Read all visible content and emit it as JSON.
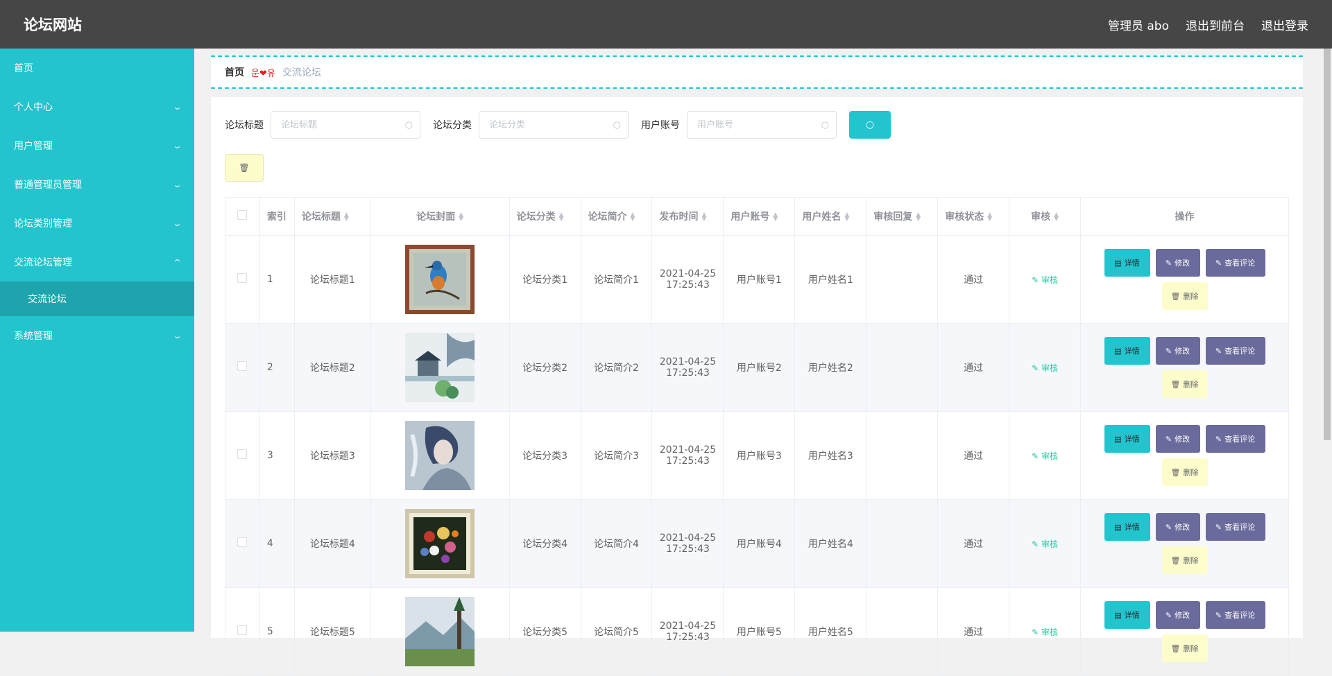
{
  "header": {
    "brand": "论坛网站",
    "admin_label": "管理员 abo",
    "back_to_front": "退出到前台",
    "logout": "退出登录"
  },
  "sidebar": {
    "items": [
      {
        "label": "首页",
        "has_arrow": false
      },
      {
        "label": "个人中心",
        "has_arrow": true
      },
      {
        "label": "用户管理",
        "has_arrow": true
      },
      {
        "label": "普通管理员管理",
        "has_arrow": true
      },
      {
        "label": "论坛类别管理",
        "has_arrow": true
      },
      {
        "label": "交流论坛管理",
        "has_arrow": true,
        "expanded": true
      },
      {
        "label": "系统管理",
        "has_arrow": true
      }
    ],
    "sub_item": "交流论坛"
  },
  "breadcrumb": {
    "home": "首页",
    "separator": "운❤유",
    "current": "交流论坛"
  },
  "search": {
    "title_label": "论坛标题",
    "title_placeholder": "论坛标题",
    "category_label": "论坛分类",
    "category_placeholder": "论坛分类",
    "account_label": "用户账号",
    "account_placeholder": "用户账号"
  },
  "table": {
    "headers": {
      "index": "索引",
      "title": "论坛标题",
      "cover": "论坛封面",
      "category": "论坛分类",
      "intro": "论坛简介",
      "time": "发布时间",
      "account": "用户账号",
      "name": "用户姓名",
      "reply": "审核回复",
      "status": "审核状态",
      "audit": "审核",
      "ops": "操作"
    },
    "rows": [
      {
        "index": "1",
        "title": "论坛标题1",
        "cover": "kingfisher painting",
        "category": "论坛分类1",
        "intro": "论坛简介1",
        "date": "2021-04-25",
        "time": "17:25:43",
        "account": "用户账号1",
        "name": "用户姓名1",
        "reply": "",
        "status": "通过",
        "audit": "审核"
      },
      {
        "index": "2",
        "title": "论坛标题2",
        "cover": "watercolor house painting",
        "category": "论坛分类2",
        "intro": "论坛简介2",
        "date": "2021-04-25",
        "time": "17:25:43",
        "account": "用户账号2",
        "name": "用户姓名2",
        "reply": "",
        "status": "通过",
        "audit": "审核"
      },
      {
        "index": "3",
        "title": "论坛标题3",
        "cover": "portrait painting",
        "category": "论坛分类3",
        "intro": "论坛简介3",
        "date": "2021-04-25",
        "time": "17:25:43",
        "account": "用户账号3",
        "name": "用户姓名3",
        "reply": "",
        "status": "通过",
        "audit": "审核"
      },
      {
        "index": "4",
        "title": "论坛标题4",
        "cover": "flower still life painting",
        "category": "论坛分类4",
        "intro": "论坛简介4",
        "date": "2021-04-25",
        "time": "17:25:43",
        "account": "用户账号4",
        "name": "用户姓名4",
        "reply": "",
        "status": "通过",
        "audit": "审核"
      },
      {
        "index": "5",
        "title": "论坛标题5",
        "cover": "landscape painting",
        "category": "论坛分类5",
        "intro": "论坛简介5",
        "date": "2021-04-25",
        "time": "17:25:43",
        "account": "用户账号5",
        "name": "用户姓名5",
        "reply": "",
        "status": "通过",
        "audit": "审核"
      }
    ],
    "ops": {
      "detail": "详情",
      "edit": "修改",
      "comments": "查看评论",
      "delete": "删除"
    }
  },
  "colors": {
    "topbar": "#464646",
    "accent": "#23c4cd",
    "purple_button": "#6b6a9c",
    "delete_button": "#fdfdcc"
  }
}
